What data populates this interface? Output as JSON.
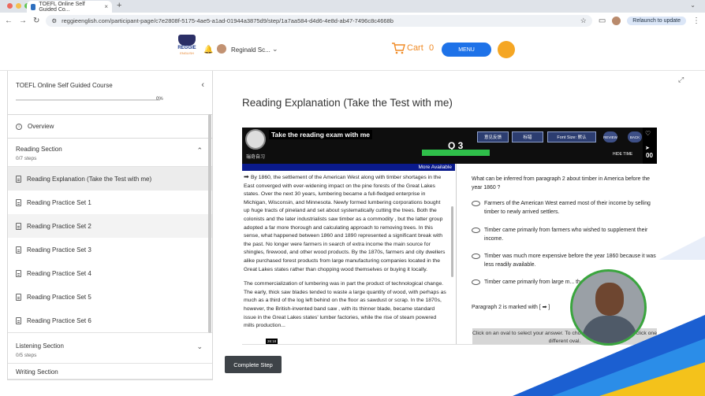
{
  "browser": {
    "tab_title": "TOEFL Online Self Guided Co...",
    "url": "reggieenglish.com/participant-page/c7e2808f-5175-4ae5-a1ad-01944a3875d9/step/1a7aa584-d4d6-4e8d-ab47-7496c8c4668b",
    "relaunch_label": "Relaunch to update",
    "colors": {
      "tab_strip": "#dfe3e9",
      "url_bar": "#eef1f5"
    }
  },
  "header": {
    "logo_text": "REGGIE",
    "logo_sub": "ENGLISH",
    "user_name": "Reginald Sc...",
    "cart_label": "Cart",
    "cart_count": "0",
    "menu_label": "MENU",
    "colors": {
      "accent_orange": "#f08a24",
      "menu_blue": "#1e72e8"
    }
  },
  "sidebar": {
    "course_title": "TOEFL Online Self Guided Course",
    "progress_text": "0%",
    "progress_fraction": 0,
    "overview_label": "Overview",
    "reading_section": {
      "title": "Reading Section",
      "steps": "0/7 steps",
      "items": [
        {
          "label": "Reading Explanation (Take the Test with me)",
          "state": "active"
        },
        {
          "label": "Reading Practice Set 1",
          "state": ""
        },
        {
          "label": "Reading Practice Set 2",
          "state": "hover"
        },
        {
          "label": "Reading Practice Set 3",
          "state": ""
        },
        {
          "label": "Reading Practice Set 4",
          "state": ""
        },
        {
          "label": "Reading Practice Set 5",
          "state": ""
        },
        {
          "label": "Reading Practice Set 6",
          "state": ""
        }
      ]
    },
    "listening_section": {
      "title": "Listening Section",
      "steps": "0/5 steps"
    },
    "writing_section": {
      "title": "Writing Section"
    }
  },
  "main": {
    "title": "Reading Explanation (Take the Test with me)",
    "complete_label": "Complete Step"
  },
  "video": {
    "caption": "Take the reading exam with me",
    "logo_sub": "瑞奇自习",
    "question_number": "Q 3",
    "buttons": [
      "意见反馈",
      "标错",
      "Font Size: 默认"
    ],
    "round_buttons": [
      "REVIEW",
      "BACK"
    ],
    "hide_time": "HIDE TIME",
    "time_digits": "00",
    "more_available": "More Available",
    "timestamp": "26:18",
    "passage": [
      "By 1860, the settlement of the American West along with timber shortages in the East converged with ever-widening impact on the pine forests of the Great Lakes states. Over the next 30 years, lumbering became a full-fledged enterprise in Michigan, Wisconsin, and Minnesota. Newly formed lumbering corporations bought up huge tracts of pineland and set about systematically cutting the trees. Both the colonists and the later industrialists saw timber as a commodity , but the latter group adopted a far more thorough and calculating approach to removing trees. In this sense, what happened between 1860 and 1890 represented a significant break with the past. No longer were farmers in search of extra income the main source for shingles, firewood, and other wood products. By the 1870s, farmers and city dwellers alike purchased forest products from large manufacturing companies located in the Great Lakes states rather than chopping wood themselves or buying it locally.",
      "The commercialization of lumbering was in part the product of technological change. The early, thick saw blades tended to waste a large quantity of wood, with perhaps as much as a third of the log left behind on the floor as sawdust or scrap. In the 1870s, however, the British-invented band saw , with its thinner blade, became standard issue in the Great Lakes states' lumber factories, while the rise of steam powered mills production..."
    ],
    "question": "What can be inferred from paragraph 2 about timber in America before the year 1860 ?",
    "options": [
      "Farmers of the American West earned most of their income by selling timber to newly arrived settlers.",
      "Timber came primarily from farmers who wished to supplement their income.",
      "Timber was much more expensive before the year 1860 because it was less readily available.",
      "Timber came primarily from large m... the East."
    ],
    "paragraph_note": "Paragraph 2 is marked with [ ➡ ]",
    "instruction": "Click on an oval to select your answer. To choose a different answer, click one different oval."
  }
}
